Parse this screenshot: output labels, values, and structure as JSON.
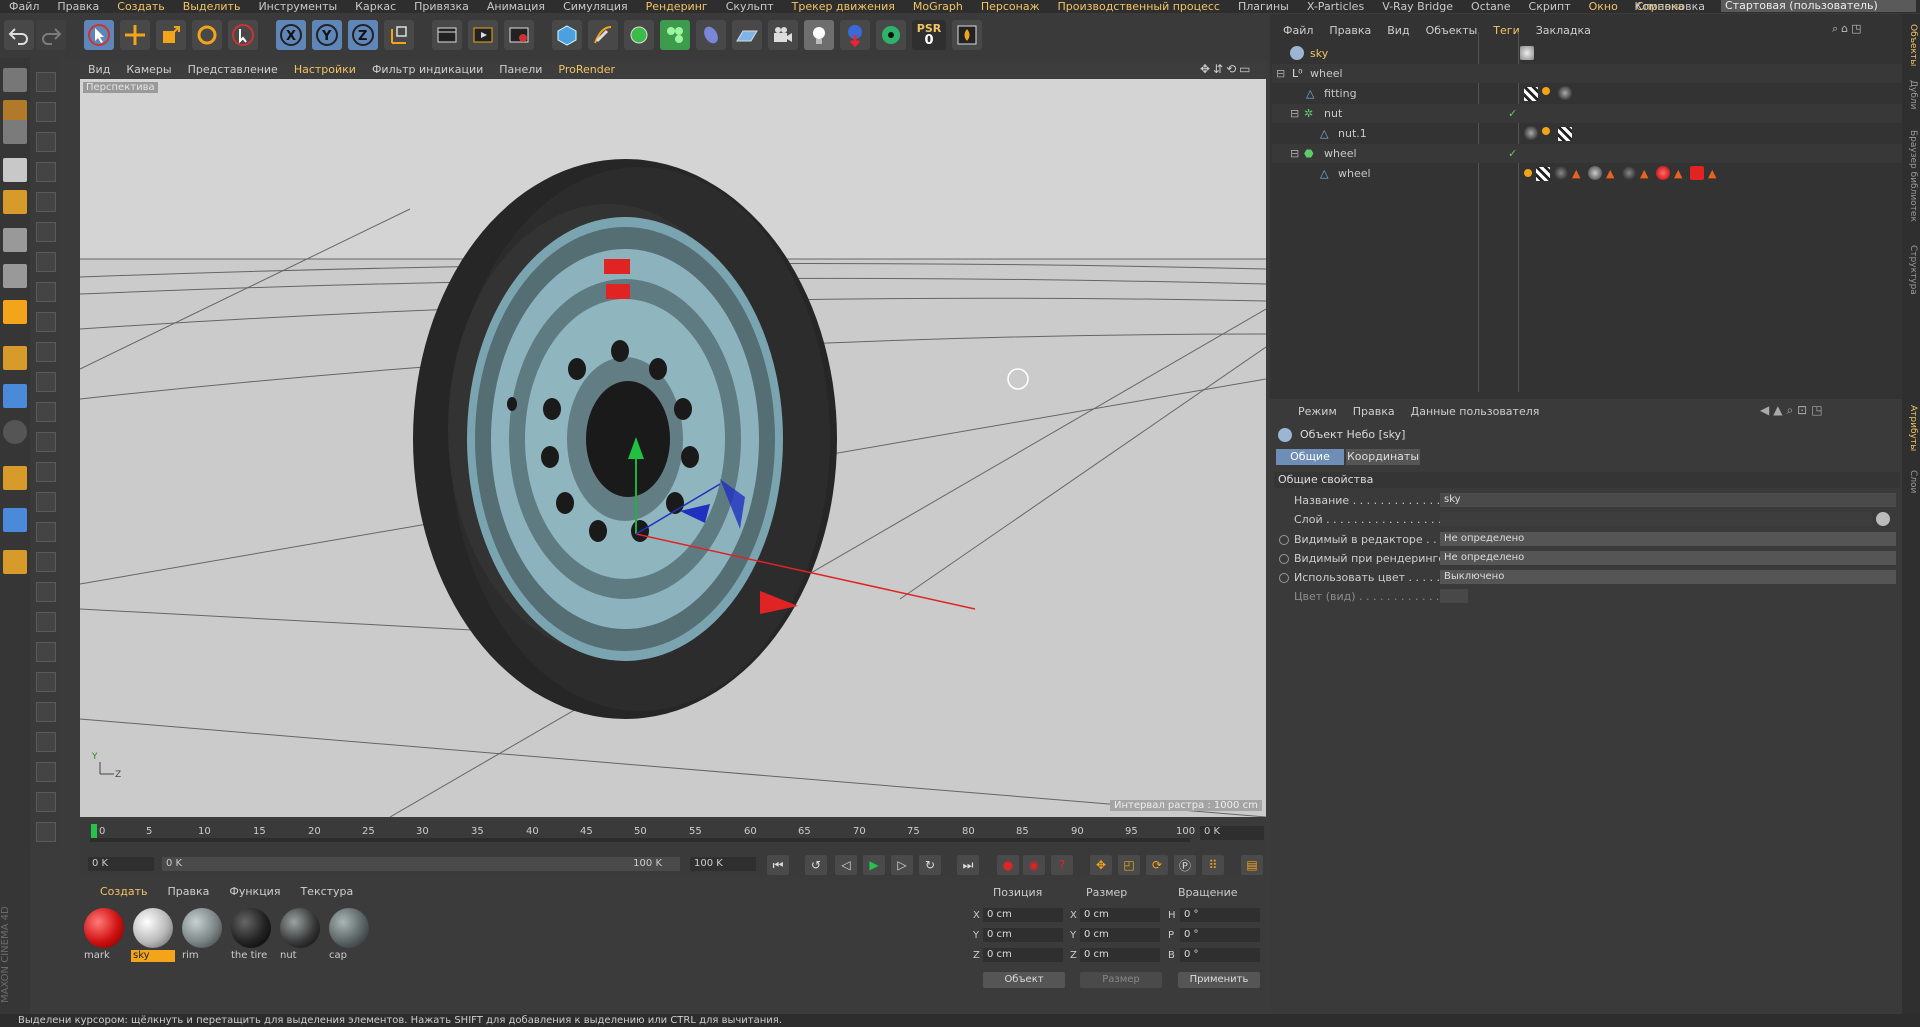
{
  "menubar": {
    "items": [
      "Файл",
      "Правка",
      "Создать",
      "Выделить",
      "Инструменты",
      "Каркас",
      "Привязка",
      "Анимация",
      "Симуляция",
      "Рендеринг",
      "Скульпт",
      "Трекер движения",
      "MoGraph",
      "Персонаж",
      "Производственный процесс",
      "Плагины",
      "X-Particles",
      "V-Ray Bridge",
      "Octane",
      "Скрипт",
      "Окно",
      "Справка"
    ],
    "highlighted": [
      "Создать",
      "Выделить",
      "Рендеринг",
      "Трекер движения",
      "MoGraph",
      "Персонаж",
      "Производственный процесс",
      "Окно",
      "Справка"
    ],
    "layout_label": "Компоновка",
    "layout_value": "Стартовая (пользователь)"
  },
  "toolbar": {
    "psr_label": "PSR",
    "psr_value": "0"
  },
  "viewport": {
    "menu": [
      "Вид",
      "Камеры",
      "Представление",
      "Настройки",
      "Фильтр индикации",
      "Панели",
      "ProRender"
    ],
    "menu_highlighted": [
      "Настройки",
      "ProRender"
    ],
    "label": "Перспектива",
    "grid_label": "Интервал растра : 1000 cm"
  },
  "timeline": {
    "ticks": [
      "0",
      "5",
      "10",
      "15",
      "20",
      "25",
      "30",
      "35",
      "40",
      "45",
      "50",
      "55",
      "60",
      "65",
      "70",
      "75",
      "80",
      "85",
      "90",
      "95",
      "100"
    ],
    "current_frame": "0 K",
    "start_field": "0 K",
    "range_start": "0 K",
    "range_end": "100 K",
    "end_field": "100 K"
  },
  "materials": {
    "menu": [
      "Создать",
      "Правка",
      "Функция",
      "Текстура"
    ],
    "items": [
      {
        "name": "mark",
        "color": "#d01010"
      },
      {
        "name": "sky",
        "color": "#b9b9b9",
        "selected": true
      },
      {
        "name": "rim",
        "color": "#7c8585"
      },
      {
        "name": "the tire",
        "color": "#222222"
      },
      {
        "name": "nut",
        "color": "#3a3a3a"
      },
      {
        "name": "cap",
        "color": "#5a6464"
      }
    ]
  },
  "coords": {
    "headers": [
      "Позиция",
      "Размер",
      "Вращение"
    ],
    "rows": [
      {
        "l1": "X",
        "v1": "0 cm",
        "l2": "X",
        "v2": "0 cm",
        "l3": "H",
        "v3": "0 °"
      },
      {
        "l1": "Y",
        "v1": "0 cm",
        "l2": "Y",
        "v2": "0 cm",
        "l3": "P",
        "v3": "0 °"
      },
      {
        "l1": "Z",
        "v1": "0 cm",
        "l2": "Z",
        "v2": "0 cm",
        "l3": "B",
        "v3": "0 °"
      }
    ],
    "mode_select": "Объект",
    "size_select": "Размер",
    "apply": "Применить"
  },
  "status": "Выделени курсором: щёлкнуть и перетащить для выделения элементов. Нажать SHIFT для добавления к выделению или CTRL для вычитания.",
  "brand": "MAXON CINEMA 4D",
  "objects": {
    "menu": [
      "Файл",
      "Правка",
      "Вид",
      "Объекты",
      "Теги",
      "Закладка"
    ],
    "menu_highlighted": [
      "Теги"
    ],
    "tree": [
      {
        "name": "sky",
        "indent": 0,
        "selected": true
      },
      {
        "name": "wheel",
        "indent": 0
      },
      {
        "name": "fitting",
        "indent": 1
      },
      {
        "name": "nut",
        "indent": 1
      },
      {
        "name": "nut.1",
        "indent": 2
      },
      {
        "name": "wheel",
        "indent": 1
      },
      {
        "name": "wheel",
        "indent": 2
      }
    ]
  },
  "attributes": {
    "menu": [
      "Режим",
      "Правка",
      "Данные пользователя"
    ],
    "title": "Объект Небо [sky]",
    "tabs": [
      "Общие",
      "Координаты"
    ],
    "section": "Общие свойства",
    "rows": [
      {
        "label": "Название . . . . . . . . . . . . . .",
        "value": "sky"
      },
      {
        "label": "Слой . . . . . . . . . . . . . . . . . .",
        "value": ""
      },
      {
        "label": "Видимый в редакторе . . .",
        "value": "Не определено"
      },
      {
        "label": "Видимый при рендеринге",
        "value": "Не определено"
      },
      {
        "label": "Использовать цвет . . . . .",
        "value": "Выключено"
      },
      {
        "label": "Цвет (вид) . . . . . . . . . . . .",
        "value": ""
      }
    ]
  },
  "sidetabs": [
    "Объекты",
    "Дубли",
    "Браузер библиотек",
    "Структура",
    "Атрибуты",
    "Слои"
  ]
}
